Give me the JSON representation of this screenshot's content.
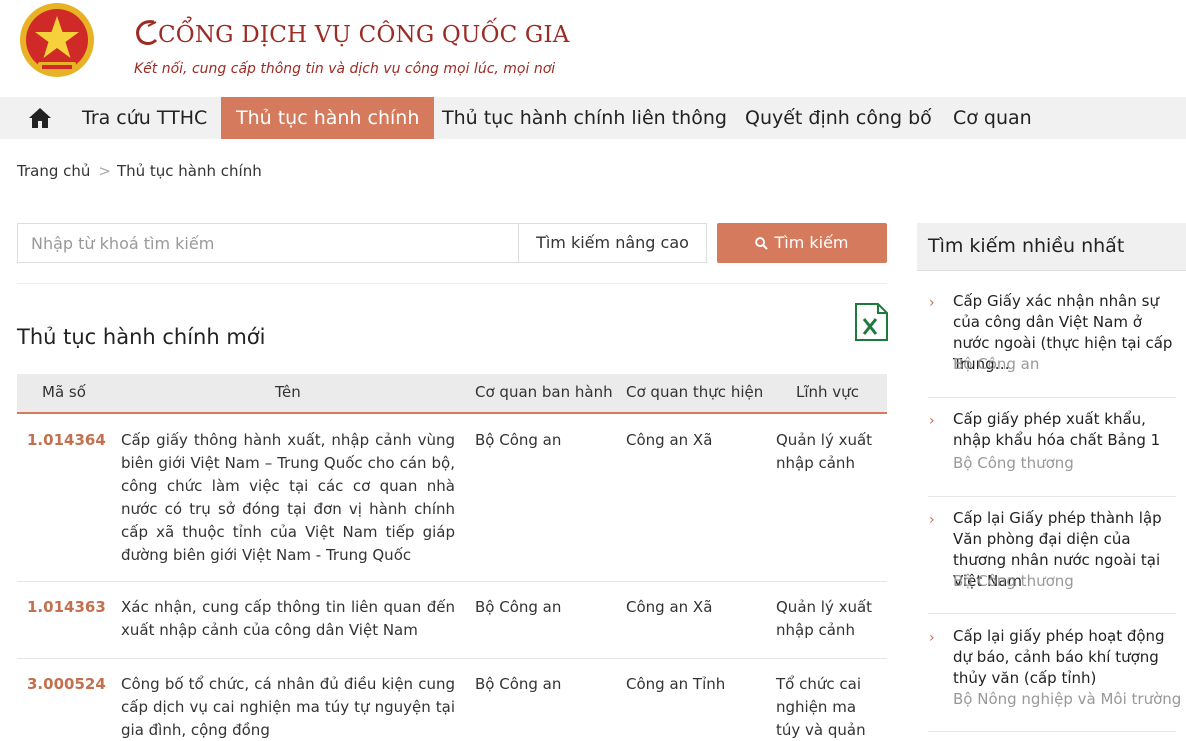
{
  "header": {
    "title": "CỔNG DỊCH VỤ CÔNG QUỐC GIA",
    "subtitle": "Kết nối, cung cấp thông tin và dịch vụ công mọi lúc, mọi nơi"
  },
  "nav": {
    "items": [
      {
        "label": "Tra cứu TTHC"
      },
      {
        "label": "Thủ tục hành chính",
        "active": true
      },
      {
        "label": "Thủ tục hành chính liên thông"
      },
      {
        "label": "Quyết định công bố"
      },
      {
        "label": "Cơ quan"
      }
    ]
  },
  "breadcrumb": {
    "home": "Trang chủ",
    "current": "Thủ tục hành chính"
  },
  "search": {
    "placeholder": "Nhập từ khoá tìm kiếm",
    "advanced_label": "Tìm kiếm nâng cao",
    "button_label": "Tìm kiếm"
  },
  "section": {
    "title": "Thủ tục hành chính mới"
  },
  "table": {
    "headers": [
      "Mã số",
      "Tên",
      "Cơ quan ban hành",
      "Cơ quan thực hiện",
      "Lĩnh vực"
    ],
    "rows": [
      {
        "code": "1.014364",
        "name": "Cấp giấy thông hành xuất, nhập cảnh vùng biên giới Việt Nam – Trung Quốc cho cán bộ, công chức làm việc tại các cơ quan nhà nước có trụ sở đóng tại đơn vị hành chính cấp xã thuộc tỉnh của Việt Nam tiếp giáp đường biên giới Việt Nam - Trung Quốc",
        "issuer": "Bộ Công an",
        "executor": "Công an Xã",
        "field": "Quản lý xuất nhập cảnh"
      },
      {
        "code": "1.014363",
        "name": "Xác nhận, cung cấp thông tin liên quan đến xuất nhập cảnh của công dân Việt Nam",
        "issuer": "Bộ Công an",
        "executor": "Công an Xã",
        "field": "Quản lý xuất nhập cảnh"
      },
      {
        "code": "3.000524",
        "name": "Công bố tổ chức, cá nhân đủ điều kiện cung cấp dịch vụ cai nghiện ma túy tự nguyện tại gia đình, cộng đồng",
        "issuer": "Bộ Công an",
        "executor": "Công an Tỉnh",
        "field": "Tổ chức cai nghiện ma túy và quản lý sau"
      }
    ]
  },
  "sidebar": {
    "title": "Tìm kiếm nhiều nhất",
    "items": [
      {
        "title": "Cấp Giấy xác nhận nhân sự của công dân Việt Nam ở nước ngoài (thực hiện tại cấp Trung…",
        "org": "Bộ Công an"
      },
      {
        "title": "Cấp giấy phép xuất khẩu, nhập khẩu hóa chất Bảng 1",
        "org": "Bộ Công thương"
      },
      {
        "title": "Cấp lại Giấy phép thành lập Văn phòng đại diện của thương nhân nước ngoài tại Việt Nam",
        "org": "Bộ Công thương"
      },
      {
        "title": "Cấp lại giấy phép hoạt động dự báo, cảnh báo khí tượng thủy văn (cấp tỉnh)",
        "org": "Bộ Nông nghiệp và Môi trường"
      }
    ]
  },
  "icons": {
    "emblem": "national-emblem-icon",
    "home": "home-icon",
    "search": "search-icon",
    "excel": "excel-export-icon",
    "chevron": "chevron-right-icon"
  },
  "colors": {
    "accent": "#d57a5c",
    "brand": "#9b2b23",
    "code": "#c3704e",
    "excel": "#1e7a3a"
  }
}
